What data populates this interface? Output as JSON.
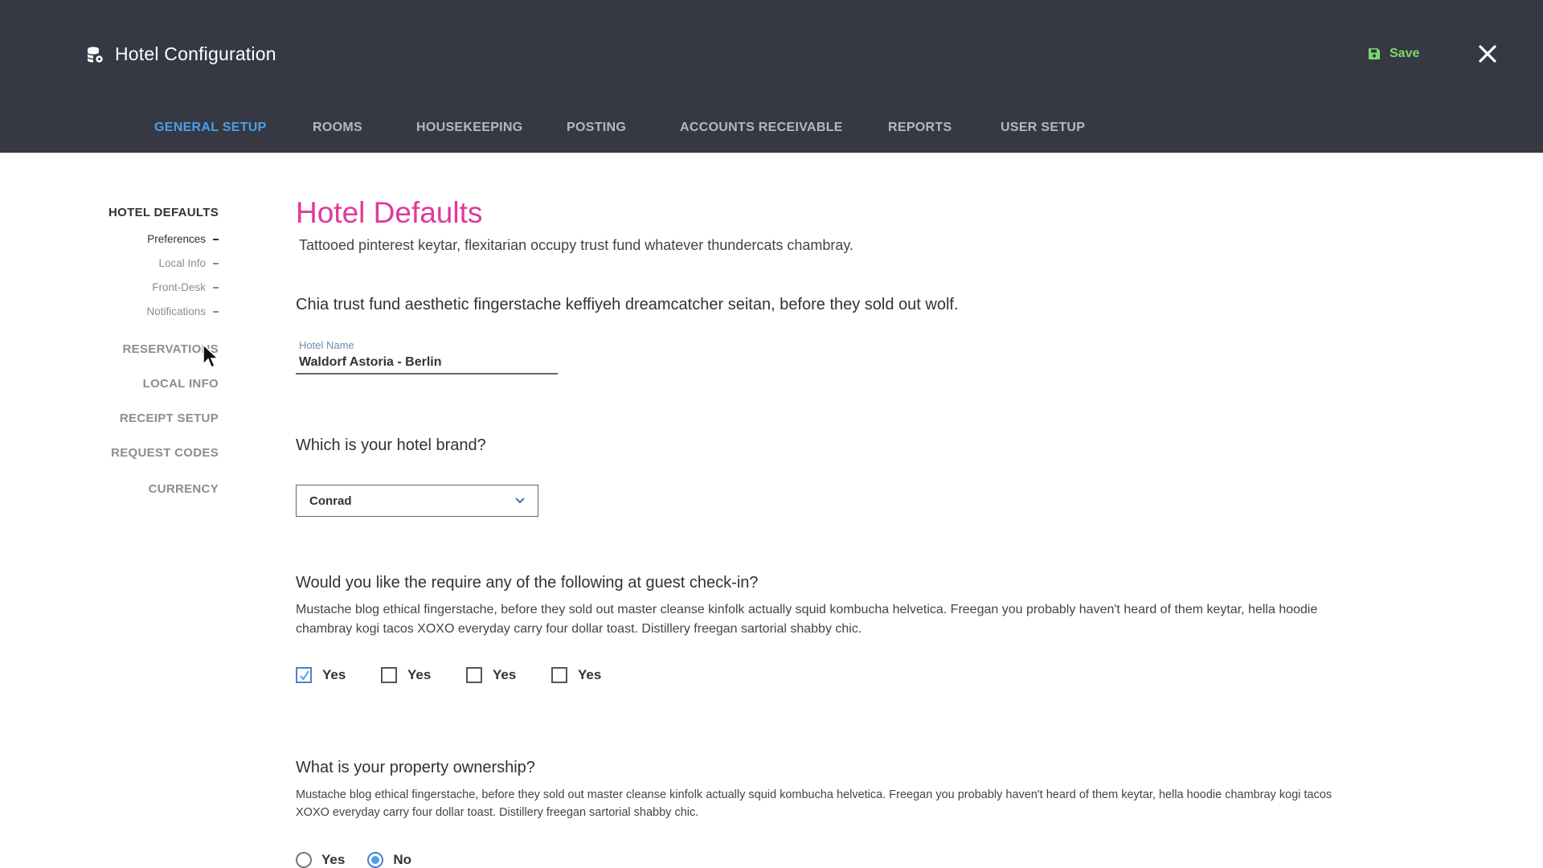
{
  "app": {
    "title": "Hotel Configuration",
    "icon": "database-gear-icon",
    "save_label": "Save",
    "save_color": "#7bd86e",
    "close_icon": "close-icon"
  },
  "tabs": [
    {
      "label": "GENERAL SETUP",
      "active": true
    },
    {
      "label": "ROOMS",
      "active": false
    },
    {
      "label": "HOUSEKEEPING",
      "active": false
    },
    {
      "label": "POSTING",
      "active": false
    },
    {
      "label": "ACCOUNTS RECEIVABLE",
      "active": false
    },
    {
      "label": "REPORTS",
      "active": false
    },
    {
      "label": "USER SETUP",
      "active": false
    }
  ],
  "sidebar": {
    "sections": [
      {
        "label": "HOTEL DEFAULTS",
        "current": true
      },
      {
        "label": "RESERVATIONS",
        "current": false
      },
      {
        "label": "LOCAL INFO",
        "current": false
      },
      {
        "label": "RECEIPT SETUP",
        "current": false
      },
      {
        "label": "REQUEST CODES",
        "current": false
      },
      {
        "label": "CURRENCY",
        "current": false
      }
    ],
    "subitems": [
      {
        "label": "Preferences",
        "current": true
      },
      {
        "label": "Local Info",
        "current": false
      },
      {
        "label": "Front-Desk",
        "current": false
      },
      {
        "label": "Notifications",
        "current": false
      }
    ]
  },
  "main": {
    "title": "Hotel Defaults",
    "subtitle": "Tattooed pinterest keytar, flexitarian occupy trust fund whatever thundercats chambray.",
    "lead": "Chia trust fund aesthetic fingerstache keffiyeh dreamcatcher seitan, before they sold out wolf.",
    "hotel_name": {
      "label": "Hotel Name",
      "value": "Waldorf Astoria - Berlin"
    },
    "brand": {
      "question": "Which is your hotel brand?",
      "selected": "Conrad"
    },
    "checkin": {
      "question": "Would you like the require any of the following at guest check-in?",
      "description": "Mustache blog ethical fingerstache, before they sold out master cleanse kinfolk actually squid kombucha helvetica. Freegan you probably haven't heard of them keytar, hella hoodie chambray kogi tacos XOXO everyday carry four dollar toast. Distillery freegan sartorial shabby chic.",
      "options": [
        {
          "label": "Yes",
          "checked": true
        },
        {
          "label": "Yes",
          "checked": false
        },
        {
          "label": "Yes",
          "checked": false
        },
        {
          "label": "Yes",
          "checked": false
        }
      ]
    },
    "ownership": {
      "question": "What is your property ownership?",
      "description": "Mustache blog ethical fingerstache, before they sold out master cleanse kinfolk actually squid kombucha helvetica. Freegan you probably haven't heard of them keytar, hella hoodie chambray kogi tacos XOXO everyday carry four dollar toast. Distillery freegan sartorial shabby chic.",
      "options": [
        {
          "label": "Yes",
          "checked": false
        },
        {
          "label": "No",
          "checked": true
        }
      ]
    }
  },
  "colors": {
    "header_bg": "#363943",
    "accent_blue": "#4d9ee8",
    "title_pink": "#e0389b",
    "save_green": "#7bd86e"
  }
}
